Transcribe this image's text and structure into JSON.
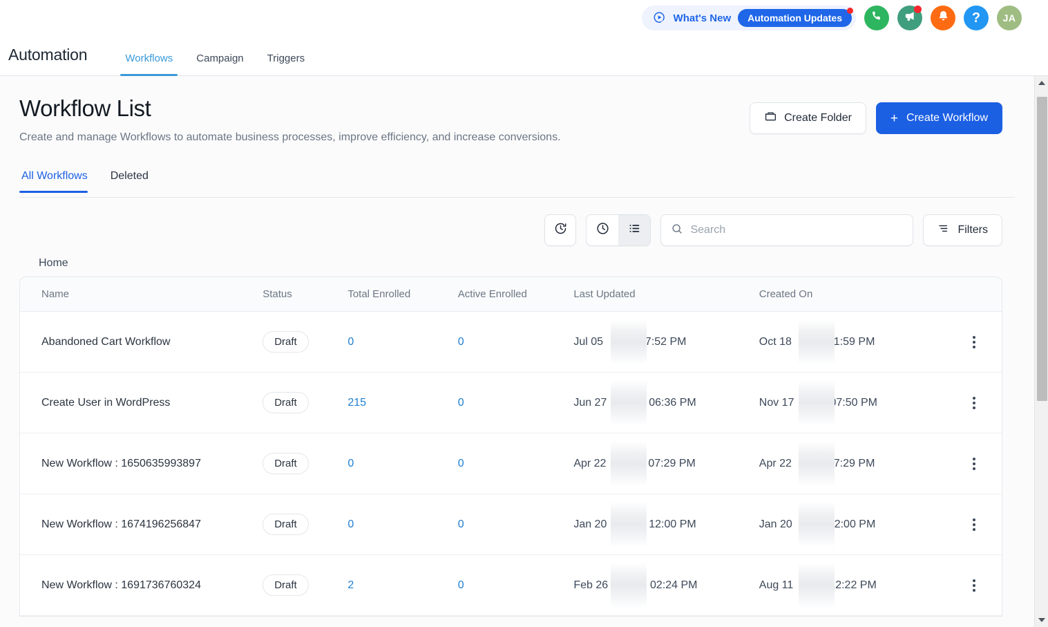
{
  "topbar": {
    "whats_new_label": "What's New",
    "whats_new_badge": "Automation Updates",
    "whats_new_icon": "play-cursor-icon",
    "phone_icon": "phone-icon",
    "megaphone_icon": "megaphone-icon",
    "bell_icon": "bell-icon",
    "help_label": "?",
    "avatar_initials": "JA",
    "colors": {
      "pill_bg": "#eef3fe",
      "pill_text": "#1f66e8",
      "badge_bg": "#1f66e8",
      "dot": "#f4282d",
      "phone": "#2eb55f",
      "megaphone": "#3f9e7e",
      "bell": "#ff6b12",
      "help": "#2196f3",
      "avatar": "#9fbd83"
    }
  },
  "appnav": {
    "title": "Automation",
    "tabs": [
      {
        "label": "Workflows",
        "active": true
      },
      {
        "label": "Campaign",
        "active": false
      },
      {
        "label": "Triggers",
        "active": false
      }
    ],
    "active_color": "#3a9ad9"
  },
  "page": {
    "title": "Workflow List",
    "subtitle": "Create and manage Workflows to automate business processes, improve efficiency, and increase conversions.",
    "actions": {
      "create_folder_label": "Create Folder",
      "create_folder_icon": "folder-icon",
      "create_workflow_label": "Create Workflow",
      "create_workflow_plus": "+",
      "primary_color": "#1b5fe3"
    },
    "subtabs": [
      {
        "label": "All Workflows",
        "active": true
      },
      {
        "label": "Deleted",
        "active": false
      }
    ]
  },
  "toolbar": {
    "history_icon": "clock-refresh-icon",
    "recent_icon": "clock-icon",
    "list_icon": "list-view-icon",
    "list_view_active": true,
    "search_placeholder": "Search",
    "search_value": "",
    "search_icon": "search-icon",
    "filters_label": "Filters",
    "filters_icon": "filter-icon"
  },
  "breadcrumb": "Home",
  "table": {
    "columns": [
      "Name",
      "Status",
      "Total Enrolled",
      "Active Enrolled",
      "Last Updated",
      "Created On"
    ],
    "rows": [
      {
        "name": "Abandoned Cart Workflow",
        "status": "Draft",
        "total_enrolled": "0",
        "active_enrolled": "0",
        "last_updated_prefix": "Jul 05",
        "last_updated_suffix": "07:52 PM",
        "created_on_prefix": "Oct 18",
        "created_on_suffix": "01:59 PM",
        "menu_icon": "kebab-menu-icon"
      },
      {
        "name": "Create User in WordPress",
        "status": "Draft",
        "total_enrolled": "215",
        "active_enrolled": "0",
        "last_updated_prefix": "Jun 27",
        "last_updated_suffix": ", 06:36 PM",
        "created_on_prefix": "Nov 17",
        "created_on_suffix": "07:50 PM",
        "menu_icon": "kebab-menu-icon"
      },
      {
        "name": "New Workflow : 1650635993897",
        "status": "Draft",
        "total_enrolled": "0",
        "active_enrolled": "0",
        "last_updated_prefix": "Apr 22",
        "last_updated_suffix": ", 07:29 PM",
        "created_on_prefix": "Apr 22",
        "created_on_suffix": "07:29 PM",
        "menu_icon": "kebab-menu-icon"
      },
      {
        "name": "New Workflow : 1674196256847",
        "status": "Draft",
        "total_enrolled": "0",
        "active_enrolled": "0",
        "last_updated_prefix": "Jan 20",
        "last_updated_suffix": ", 12:00 PM",
        "created_on_prefix": "Jan 20",
        "created_on_suffix": "12:00 PM",
        "menu_icon": "kebab-menu-icon"
      },
      {
        "name": "New Workflow : 1691736760324",
        "status": "Draft",
        "total_enrolled": "2",
        "active_enrolled": "0",
        "last_updated_prefix": "Feb 26",
        "last_updated_suffix": ", 02:24 PM",
        "created_on_prefix": "Aug 11",
        "created_on_suffix": "12:22 PM",
        "menu_icon": "kebab-menu-icon"
      }
    ]
  }
}
